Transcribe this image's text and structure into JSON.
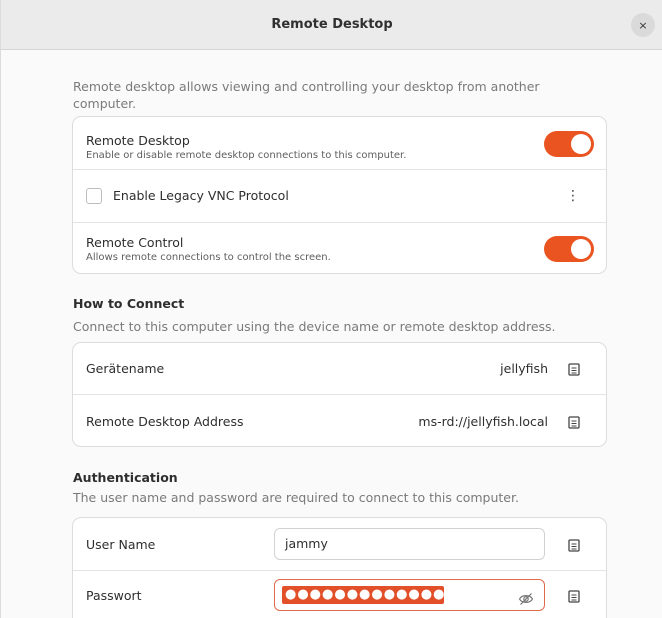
{
  "window": {
    "title": "Remote Desktop",
    "close_glyph": "×"
  },
  "intro_text": "Remote desktop allows viewing and controlling your desktop from another computer.",
  "sharing": {
    "remote_desktop": {
      "title": "Remote Desktop",
      "subtitle": "Enable or disable remote desktop connections to this computer.",
      "enabled": true
    },
    "legacy_vnc": {
      "label": "Enable Legacy VNC Protocol",
      "checked": false,
      "menu_glyph": "⋮"
    },
    "remote_control": {
      "title": "Remote Control",
      "subtitle": "Allows remote connections to control the screen.",
      "enabled": true
    }
  },
  "how_to_connect": {
    "title": "How to Connect",
    "subtitle": "Connect to this computer using the device name or remote desktop address.",
    "rows": [
      {
        "label": "Gerätename",
        "value": "jellyfish"
      },
      {
        "label": "Remote Desktop Address",
        "value": "ms-rd://jellyfish.local"
      }
    ]
  },
  "authentication": {
    "title": "Authentication",
    "subtitle": "The user name and password are required to connect to this computer.",
    "username": {
      "label": "User Name",
      "value": "jammy"
    },
    "password": {
      "label": "Passwort",
      "masked_value": "●●●●●●●●●●●●●"
    }
  },
  "colors": {
    "accent": "#e95420",
    "card_bg": "#ffffff",
    "window_bg": "#fafafa"
  },
  "icons": {
    "copy": "copy-icon",
    "eye_hidden": "eye-off-icon",
    "close": "close-icon",
    "menu": "kebab-menu-icon"
  }
}
